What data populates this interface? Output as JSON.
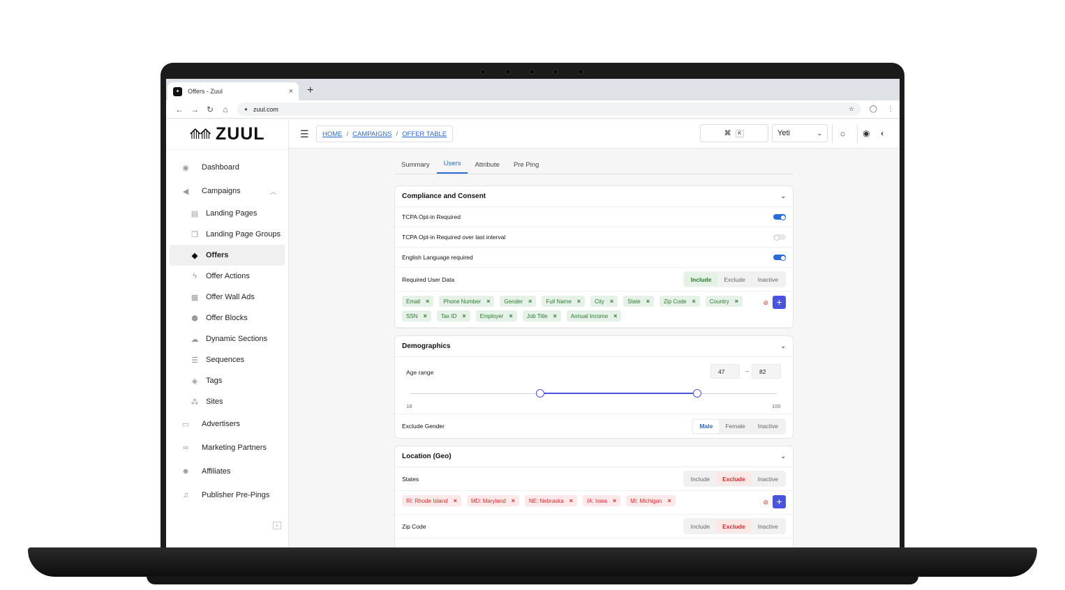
{
  "browser": {
    "tab_title": "Offers - Zuul",
    "tab_close": "×",
    "new_tab": "+",
    "url": "zuul.com"
  },
  "sidebar": {
    "logo_text": "ZUUL",
    "items": [
      {
        "label": "Dashboard",
        "icon": "palette-icon"
      },
      {
        "label": "Campaigns",
        "icon": "megaphone-icon"
      },
      {
        "label": "Landing Pages",
        "icon": "file-icon"
      },
      {
        "label": "Landing Page Groups",
        "icon": "copy-icon"
      },
      {
        "label": "Offers",
        "icon": "tags-icon"
      },
      {
        "label": "Offer Actions",
        "icon": "bolt-icon"
      },
      {
        "label": "Offer Wall Ads",
        "icon": "grid-icon"
      },
      {
        "label": "Offer Blocks",
        "icon": "cube-icon"
      },
      {
        "label": "Dynamic Sections",
        "icon": "cloud-icon"
      },
      {
        "label": "Sequences",
        "icon": "list-icon"
      },
      {
        "label": "Tags",
        "icon": "tag-icon"
      },
      {
        "label": "Sites",
        "icon": "sitemap-icon"
      },
      {
        "label": "Advertisers",
        "icon": "id-card-icon"
      },
      {
        "label": "Marketing Partners",
        "icon": "handshake-icon"
      },
      {
        "label": "Affiliates",
        "icon": "users-icon"
      },
      {
        "label": "Publisher Pre-Pings",
        "icon": "bell-icon"
      }
    ]
  },
  "topbar": {
    "breadcrumb": [
      "HOME",
      "CAMPAIGNS",
      "OFFER TABLE"
    ],
    "shortcut_symbol": "⌘",
    "shortcut_key": "K",
    "user_name": "Yeti"
  },
  "tabs": [
    "Summary",
    "Users",
    "Attribute",
    "Pre Ping"
  ],
  "compliance": {
    "title": "Compliance and Consent",
    "rows": [
      {
        "label": "TCPA Opt-in Required",
        "on": true
      },
      {
        "label": "TCPA Opt-in Required over last interval",
        "on": false
      },
      {
        "label": "English Language required",
        "on": true
      }
    ],
    "required_label": "Required User Data",
    "seg": [
      "Include",
      "Exclude",
      "Inactive"
    ],
    "chips": [
      "Email",
      "Phone Number",
      "Gender",
      "Full Name",
      "City",
      "State",
      "Zip Code",
      "Country",
      "SSN",
      "Tax ID",
      "Employer",
      "Job Title",
      "Annual Income"
    ]
  },
  "demographics": {
    "title": "Demographics",
    "age_label": "Age range",
    "age_min_value": "47",
    "age_max_value": "82",
    "dash": "–",
    "range_min": "18",
    "range_max": "100",
    "gender_label": "Exclude Gender",
    "gender_seg": [
      "Male",
      "Female",
      "Inactive"
    ]
  },
  "location": {
    "title": "Location (Geo)",
    "states_label": "States",
    "seg": [
      "Include",
      "Exclude",
      "Inactive"
    ],
    "state_chips": [
      "RI: Rhode Island",
      "MD: Maryland",
      "NE: Nebraska",
      "IA: Iowa",
      "MI: Michigan"
    ],
    "zip_label": "Zip Code"
  },
  "colors": {
    "accent": "#2a6bd6",
    "primary_button": "#4a52e0",
    "include_green": "#2a7a2f",
    "exclude_red": "#d42a2a"
  }
}
